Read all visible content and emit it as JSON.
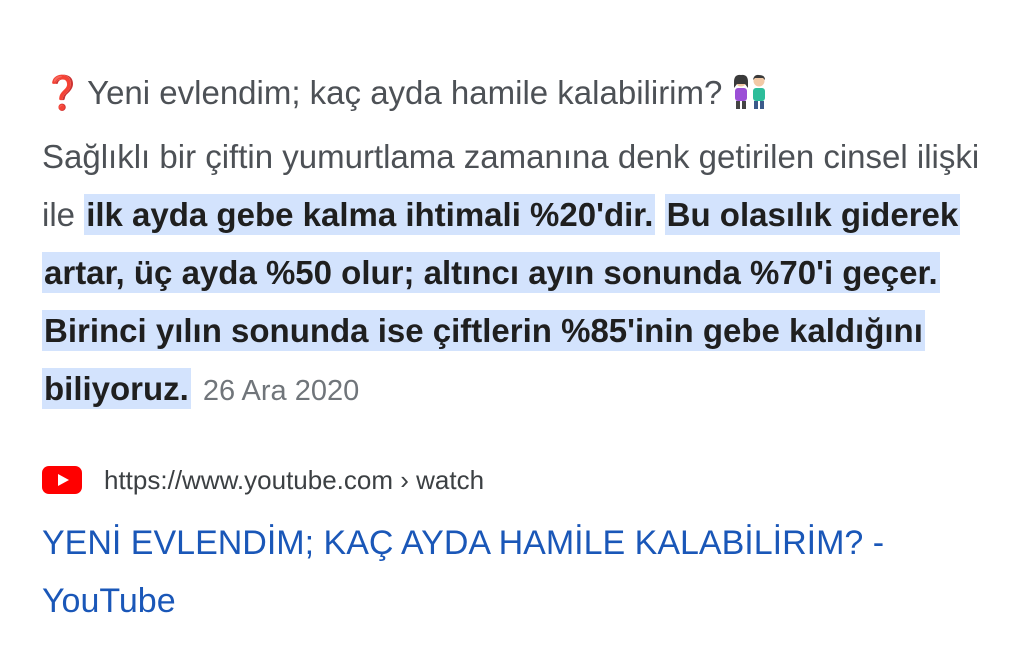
{
  "snippet": {
    "question_icon": "❓",
    "question": "Yeni evlendim; kaç ayda hamile kalabilirim?",
    "couple_emoji": "couple-emoji-icon",
    "intro": "Sağlıklı bir çiftin yumurtlama zamanına denk getirilen cinsel ilişki ile ",
    "highlight_1": "ilk ayda gebe kalma ihtimali %20'dir.",
    "highlight_2": "Bu olasılık giderek artar, üç ayda %50 olur; altıncı ayın sonunda %70'i geçer.",
    "highlight_3": "Birinci yılın sonunda ise çiftlerin %85'inin gebe kaldığını biliyoruz.",
    "date": "26 Ara 2020"
  },
  "result": {
    "source_icon": "youtube-icon",
    "url": "https://www.youtube.com › watch",
    "title": "YENİ EVLENDİM; KAÇ AYDA HAMİLE KALABİLİRİM? - YouTube"
  },
  "colors": {
    "highlight_bg": "#d3e3fd",
    "link": "#1a57b8",
    "youtube_red": "#ff0000",
    "question_red": "#d9302a"
  }
}
